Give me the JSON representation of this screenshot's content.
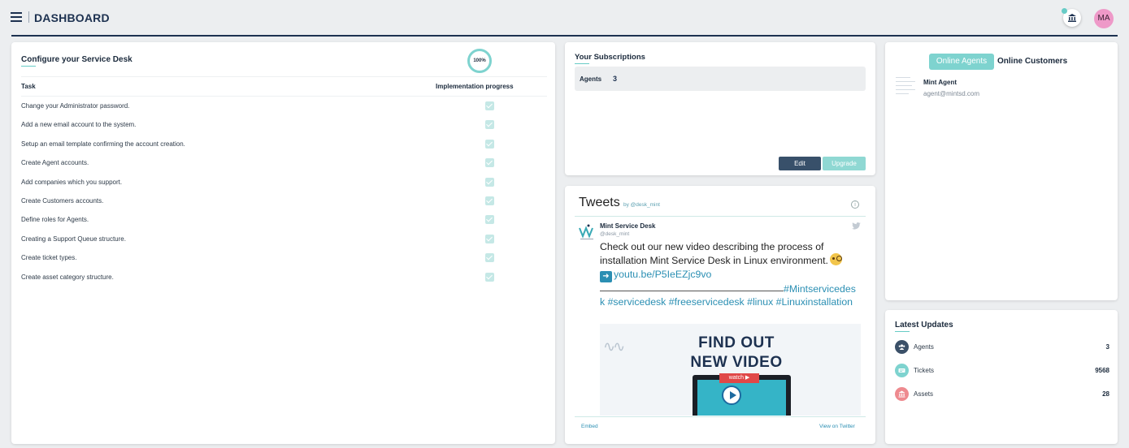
{
  "header": {
    "title": "DASHBOARD",
    "avatar_initials": "MA"
  },
  "configure": {
    "title": "Configure your Service Desk",
    "progress_label": "100%",
    "col_task": "Task",
    "col_progress": "Implementation progress",
    "tasks": [
      {
        "label": "Change your Administrator password.",
        "done": true
      },
      {
        "label": "Add a new email account to the system.",
        "done": true
      },
      {
        "label": "Setup an email template confirming the account creation.",
        "done": true
      },
      {
        "label": "Create Agent accounts.",
        "done": true
      },
      {
        "label": "Add companies which you support.",
        "done": true
      },
      {
        "label": "Create Customers accounts.",
        "done": true
      },
      {
        "label": "Define roles for Agents.",
        "done": true
      },
      {
        "label": "Creating a Support Queue structure.",
        "done": true
      },
      {
        "label": "Create ticket types.",
        "done": true
      },
      {
        "label": "Create asset category structure.",
        "done": true
      }
    ]
  },
  "subscriptions": {
    "title": "Your Subscriptions",
    "agents_label": "Agents",
    "agents_value": "3",
    "edit_label": "Edit",
    "upgrade_label": "Upgrade"
  },
  "tweets": {
    "title": "Tweets",
    "by": "by @desk_mint",
    "info_icon": "i",
    "author_name": "Mint Service Desk",
    "author_handle": "@desk_mint",
    "text_line1": "Check out our new video describing the process of",
    "text_line2": "installation Mint Service Desk in Linux environment.",
    "link": "youtu.be/P5IeEZjc9vo",
    "hashtags_line1": "#Mintservicedes",
    "hashtags_line2": "k #servicedesk #freeservicedesk #linux #Linuxinstallation",
    "media_line1": "FIND OUT",
    "media_line2": "NEW VIDEO",
    "media_watch": "watch ▶",
    "embed_label": "Embed",
    "view_label": "View on Twitter"
  },
  "online": {
    "tab_agents": "Online Agents",
    "tab_customers": "Online Customers",
    "agent_name": "Mint Agent",
    "agent_email": "agent@mintsd.com"
  },
  "updates": {
    "title": "Latest Updates",
    "items": [
      {
        "label": "Agents",
        "value": "3",
        "color": "#3b5068",
        "icon": "people-icon"
      },
      {
        "label": "Tickets",
        "value": "9568",
        "color": "#7ed3cf",
        "icon": "ticket-icon"
      },
      {
        "label": "Assets",
        "value": "28",
        "color": "#ee8a8f",
        "icon": "building-icon"
      }
    ]
  },
  "colors": {
    "accent": "#7ed3cf",
    "navy": "#1d3150",
    "pink": "#ee99c8"
  }
}
